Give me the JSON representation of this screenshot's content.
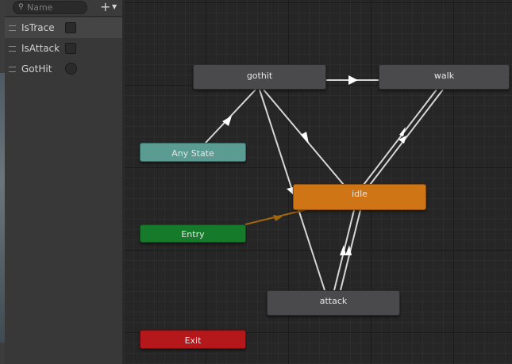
{
  "parameters": {
    "search_placeholder": "Name",
    "add_button": "+",
    "items": [
      {
        "name": "IsTrace",
        "type": "bool",
        "value": false
      },
      {
        "name": "IsAttack",
        "type": "bool",
        "value": false
      },
      {
        "name": "GotHit",
        "type": "trigger",
        "value": false
      }
    ]
  },
  "graph": {
    "states": {
      "gothit": "gothit",
      "walk": "walk",
      "any_state": "Any State",
      "idle": "idle",
      "entry": "Entry",
      "attack": "attack",
      "exit": "Exit"
    },
    "default_state": "idle",
    "transitions": [
      {
        "from": "gothit",
        "to": "walk"
      },
      {
        "from": "any_state",
        "to": "gothit"
      },
      {
        "from": "gothit",
        "to": "idle"
      },
      {
        "from": "gothit",
        "to": "attack"
      },
      {
        "from": "walk",
        "to": "idle"
      },
      {
        "from": "idle",
        "to": "walk"
      },
      {
        "from": "idle",
        "to": "attack"
      },
      {
        "from": "attack",
        "to": "idle"
      },
      {
        "from": "entry",
        "to": "idle"
      }
    ]
  },
  "colors": {
    "state_default": "#4a4a4c",
    "state_default_layer": "#d07516",
    "any_state": "#5a9b92",
    "entry": "#157a2a",
    "exit": "#b5181b",
    "transition": "#d9d9d9",
    "entry_transition": "#a0650e"
  }
}
